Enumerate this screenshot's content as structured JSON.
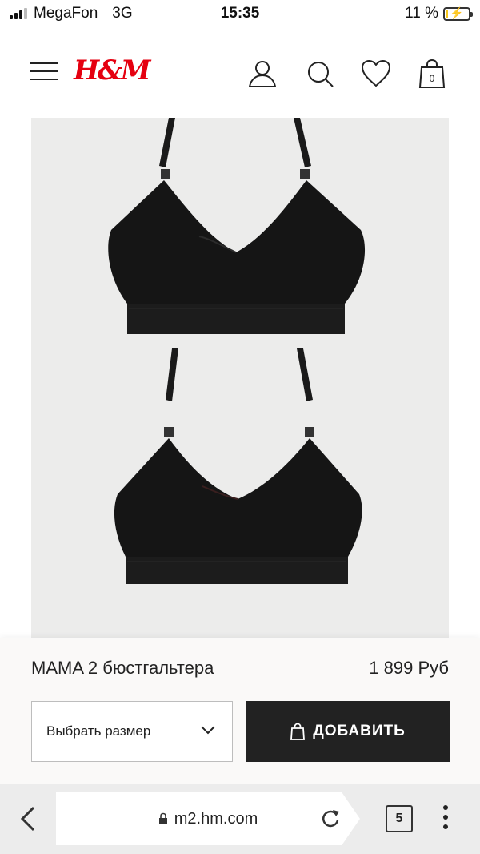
{
  "status_bar": {
    "carrier": "MegaFon",
    "network": "3G",
    "time": "15:35",
    "battery": "11 %",
    "battery_level": 0.11
  },
  "header": {
    "logo": "H&M",
    "icons": [
      "menu-icon",
      "account-icon",
      "search-icon",
      "heart-icon",
      "bag-icon"
    ],
    "bag_count": "0",
    "brand_color": "#e50010"
  },
  "product": {
    "title": "MAMA 2 бюстгальтера",
    "price": "1 899 Руб",
    "size_select": "Выбрать размер",
    "add_button": "ДОБАВИТЬ"
  },
  "browser": {
    "url": "m2.hm.com",
    "tab_count": "5"
  },
  "colors": {
    "button_bg": "#222222",
    "image_bg": "#ececeb"
  }
}
